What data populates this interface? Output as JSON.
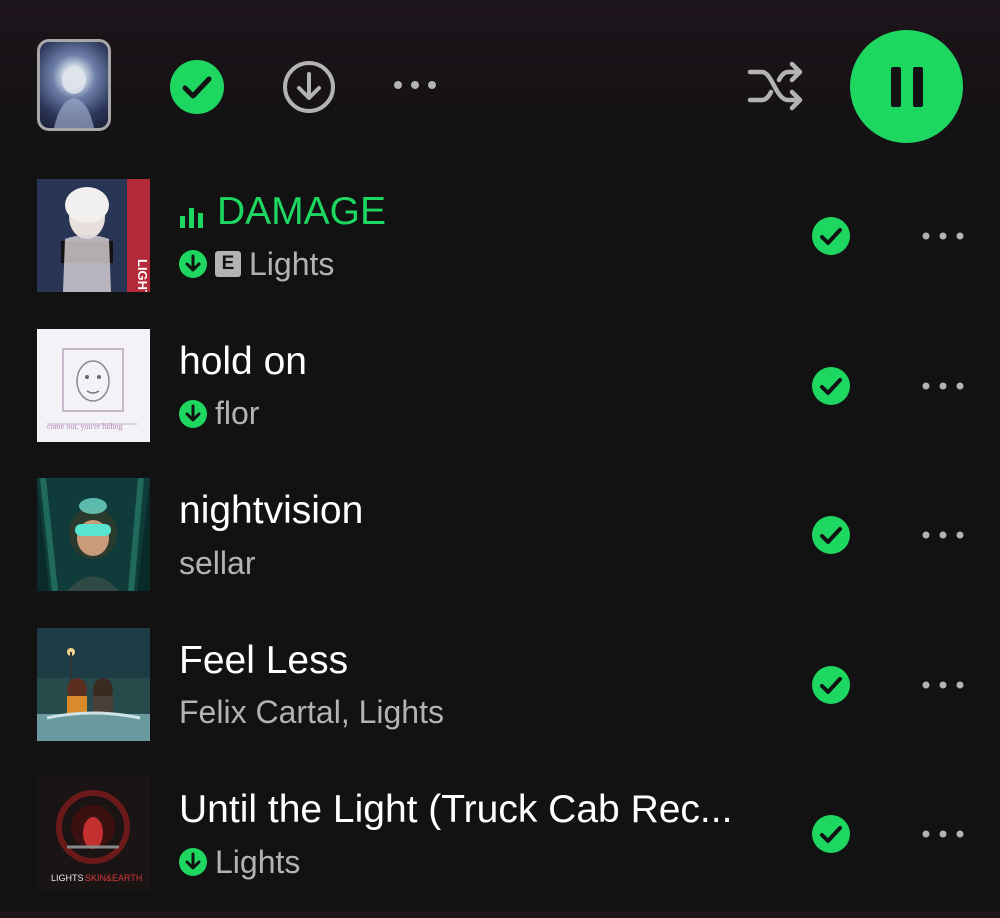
{
  "toolbar": {
    "cover": "playlist-cover",
    "saved_icon": "check-circle-icon",
    "download_icon": "download-circle-icon",
    "more_icon": "more-horizontal-icon",
    "shuffle_icon": "shuffle-icon",
    "pause_icon": "pause-icon",
    "accent": "#1ed760"
  },
  "tracks": [
    {
      "title": "DAMAGE",
      "artist": "Lights",
      "playing": true,
      "downloaded": true,
      "explicit": true,
      "explicit_label": "E"
    },
    {
      "title": "hold on",
      "artist": "flor",
      "playing": false,
      "downloaded": true,
      "explicit": false
    },
    {
      "title": "nightvision",
      "artist": "sellar",
      "playing": false,
      "downloaded": false,
      "explicit": false
    },
    {
      "title": "Feel Less",
      "artist": "Felix Cartal, Lights",
      "playing": false,
      "downloaded": false,
      "explicit": false
    },
    {
      "title": "Until the Light (Truck Cab Rec...",
      "artist": "Lights",
      "playing": false,
      "downloaded": true,
      "explicit": false
    }
  ]
}
